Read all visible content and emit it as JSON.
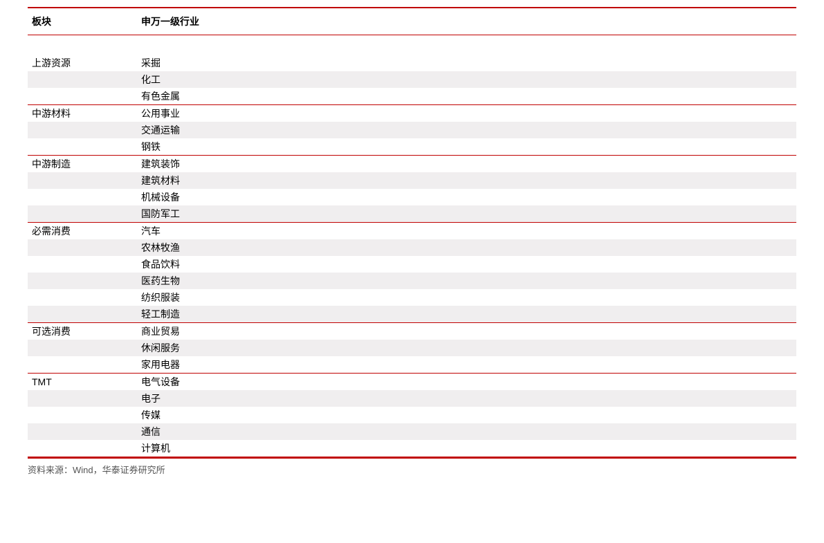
{
  "chart_data": {
    "type": "table",
    "title": "",
    "columns": [
      "板块",
      "申万一级行业"
    ],
    "sub_columns": [
      "",
      ""
    ],
    "groups": [
      {
        "name": "上游资源",
        "members": [
          "采掘",
          "化工",
          "有色金属"
        ]
      },
      {
        "name": "中游材料",
        "members": [
          "公用事业",
          "交通运输",
          "钢铁"
        ]
      },
      {
        "name": "中游制造",
        "members": [
          "建筑装饰",
          "建筑材料",
          "机械设备",
          "国防军工"
        ]
      },
      {
        "name": "必需消费",
        "members": [
          "汽车",
          "农林牧渔",
          "食品饮料",
          "医药生物",
          "纺织服装",
          "轻工制造"
        ]
      },
      {
        "name": "可选消费",
        "members": [
          "商业贸易",
          "休闲服务",
          "家用电器"
        ]
      },
      {
        "name": "TMT",
        "members": [
          "电气设备",
          "电子",
          "传媒",
          "通信",
          "计算机"
        ]
      }
    ]
  },
  "source": "资料来源：Wind，华泰证券研究所"
}
